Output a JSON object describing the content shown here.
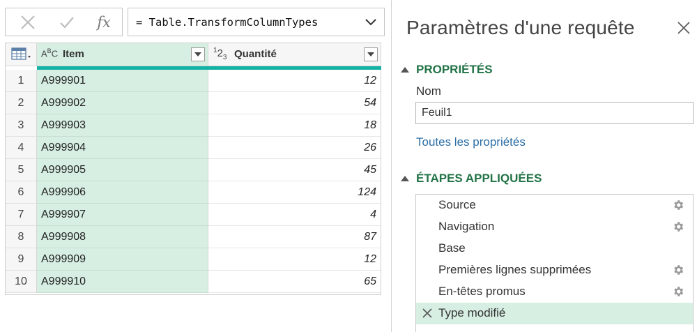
{
  "formula_bar": {
    "fx_label": "fx",
    "formula": "= Table.TransformColumnTypes"
  },
  "grid": {
    "columns": [
      {
        "type_icon": "ABC",
        "label": "Item"
      },
      {
        "type_icon": "123",
        "label": "Quantité"
      }
    ],
    "rows": [
      {
        "n": "1",
        "item": "A999901",
        "qty": "12"
      },
      {
        "n": "2",
        "item": "A999902",
        "qty": "54"
      },
      {
        "n": "3",
        "item": "A999903",
        "qty": "18"
      },
      {
        "n": "4",
        "item": "A999904",
        "qty": "26"
      },
      {
        "n": "5",
        "item": "A999905",
        "qty": "45"
      },
      {
        "n": "6",
        "item": "A999906",
        "qty": "124"
      },
      {
        "n": "7",
        "item": "A999907",
        "qty": "4"
      },
      {
        "n": "8",
        "item": "A999908",
        "qty": "87"
      },
      {
        "n": "9",
        "item": "A999909",
        "qty": "12"
      },
      {
        "n": "10",
        "item": "A999910",
        "qty": "65"
      }
    ]
  },
  "query_settings": {
    "title": "Paramètres d'une requête",
    "properties_header": "PROPRIÉTÉS",
    "name_label": "Nom",
    "name_value": "Feuil1",
    "all_properties_link": "Toutes les propriétés",
    "applied_steps_header": "ÉTAPES APPLIQUÉES",
    "steps": [
      {
        "label": "Source",
        "has_gear": true,
        "selected": false
      },
      {
        "label": "Navigation",
        "has_gear": true,
        "selected": false
      },
      {
        "label": "Base",
        "has_gear": false,
        "selected": false
      },
      {
        "label": "Premières lignes supprimées",
        "has_gear": true,
        "selected": false
      },
      {
        "label": "En-têtes promus",
        "has_gear": true,
        "selected": false
      },
      {
        "label": "Type modifié",
        "has_gear": false,
        "selected": true
      }
    ]
  },
  "colors": {
    "accent_green": "#217346",
    "selected_column_bg": "#d7efe3",
    "quality_bar": "#13b2a4",
    "link": "#2c6ea6"
  }
}
